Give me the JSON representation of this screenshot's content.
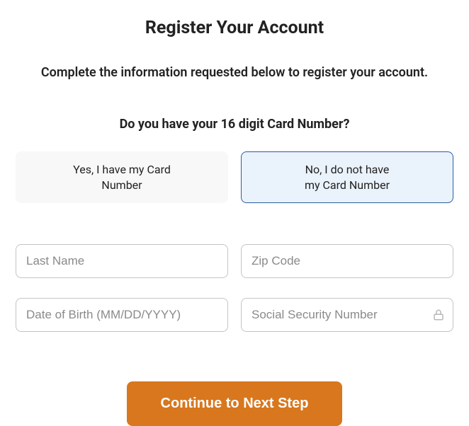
{
  "title": "Register Your Account",
  "subtitle": "Complete the information requested below to register your account.",
  "question": "Do you have your 16 digit Card Number?",
  "options": {
    "yes": "Yes, I have my Card\nNumber",
    "no": "No, I do not have\nmy Card Number"
  },
  "fields": {
    "last_name": {
      "placeholder": "Last Name",
      "value": ""
    },
    "zip_code": {
      "placeholder": "Zip Code",
      "value": ""
    },
    "dob": {
      "placeholder": "Date of Birth (MM/DD/YYYY)",
      "value": ""
    },
    "ssn": {
      "placeholder": "Social Security Number",
      "value": ""
    }
  },
  "submit_label": "Continue to Next Step"
}
